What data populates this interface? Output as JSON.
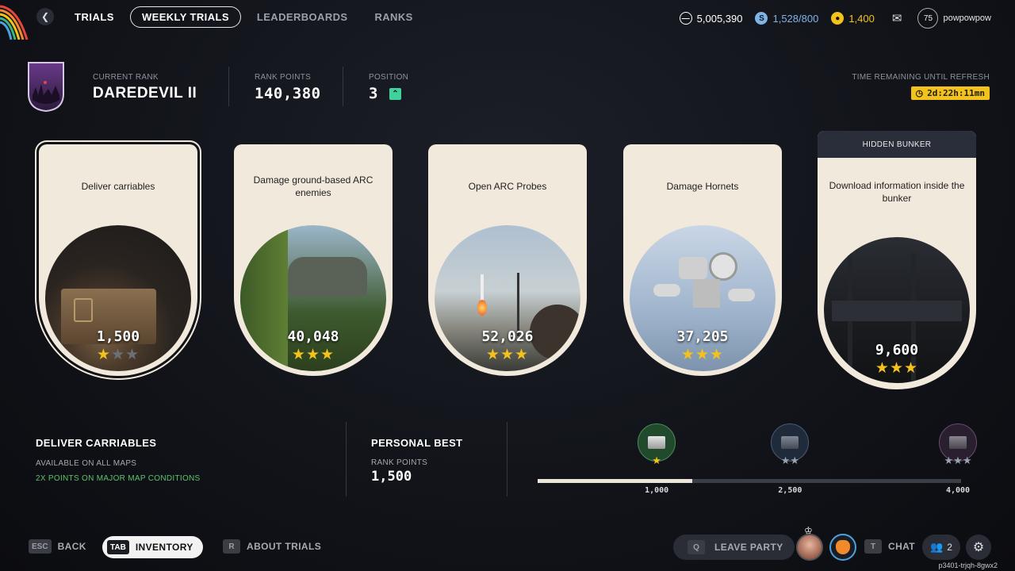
{
  "topbar": {
    "title": "TRIALS",
    "tabs": [
      {
        "label": "WEEKLY TRIALS",
        "active": true
      },
      {
        "label": "LEADERBOARDS",
        "active": false
      },
      {
        "label": "RANKS",
        "active": false
      }
    ],
    "currencies": [
      {
        "icon": "coin-icon",
        "value": "5,005,390",
        "color": "#ffffff"
      },
      {
        "icon": "credits-icon",
        "value": "1,528/800",
        "color": "#7fb4e6"
      },
      {
        "icon": "tokens-icon",
        "value": "1,400",
        "color": "#f3c21b"
      }
    ],
    "user_level": "75",
    "username": "powpowpow"
  },
  "rank": {
    "current_label": "CURRENT RANK",
    "current_value": "DAREDEVIL II",
    "points_label": "RANK POINTS",
    "points_value": "140,380",
    "position_label": "POSITION",
    "position_value": "3"
  },
  "timer": {
    "label": "TIME REMAINING UNTIL REFRESH",
    "value": "2d:22h:11mn"
  },
  "cards": [
    {
      "title": "Deliver carriables",
      "value": "1,500",
      "stars": 1
    },
    {
      "title": "Damage ground-based ARC enemies",
      "value": "40,048",
      "stars": 3
    },
    {
      "title": "Open ARC Probes",
      "value": "52,026",
      "stars": 3
    },
    {
      "title": "Damage Hornets",
      "value": "37,205",
      "stars": 3
    },
    {
      "header": "HIDDEN BUNKER",
      "title": "Download information inside the bunker",
      "value": "9,600",
      "stars": 3
    }
  ],
  "details": {
    "title": "DELIVER CARRIABLES",
    "availability": "AVAILABLE ON ALL MAPS",
    "bonus": "2X POINTS ON MAJOR MAP CONDITIONS",
    "best_title": "PERSONAL BEST",
    "best_label": "RANK POINTS",
    "best_value": "1,500"
  },
  "progress": {
    "current": 1500,
    "max": 4000,
    "thresholds": [
      {
        "label": "1,000",
        "value": 1000,
        "stars": 1,
        "reached": true
      },
      {
        "label": "2,500",
        "value": 2500,
        "stars": 2,
        "reached": false
      },
      {
        "label": "4,000",
        "value": 4000,
        "stars": 3,
        "reached": false
      }
    ]
  },
  "footer": {
    "back_key": "ESC",
    "back_label": "BACK",
    "inventory_key": "TAB",
    "inventory_label": "INVENTORY",
    "about_key": "R",
    "about_label": "ABOUT TRIALS",
    "leave_key": "Q",
    "leave_label": "LEAVE PARTY",
    "chat_key": "T",
    "chat_label": "CHAT",
    "party_count": "2",
    "session_id": "p3401-trjqh-8gwx2"
  }
}
